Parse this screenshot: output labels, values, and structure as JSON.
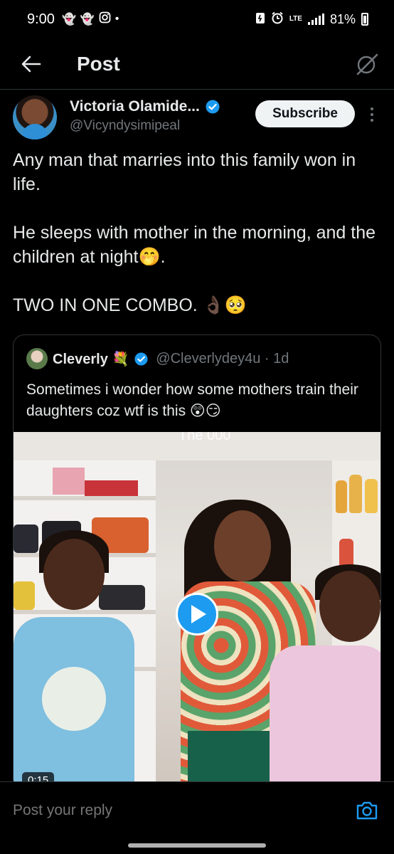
{
  "status_bar": {
    "time": "9:00",
    "left_icons": [
      "snapchat-icon",
      "snapchat-icon",
      "instagram-icon",
      "dot-icon"
    ],
    "lte": "LTE",
    "battery": "81%"
  },
  "header": {
    "title": "Post"
  },
  "author": {
    "name": "Victoria Olamide...",
    "handle": "@Vicyndysimipeal",
    "verified": true,
    "subscribe_label": "Subscribe"
  },
  "post": {
    "line1": "Any man that marries into this family won in life.",
    "line2": "He sleeps with mother in the morning, and the children at night🤭.",
    "line3": "TWO IN ONE COMBO. 👌🏿🥺"
  },
  "quote": {
    "name": "Cleverly 💐",
    "handle": "@Cleverlydey4u · 1d",
    "text": "Sometimes i wonder how some mothers train their daughters coz wtf is this 😲😏",
    "video": {
      "overlay_text": "The 000",
      "duration": "0:15"
    }
  },
  "reply": {
    "placeholder": "Post your reply"
  },
  "colors": {
    "background": "#000000",
    "accent": "#1d9bf0",
    "text_primary": "#e7e9ea",
    "text_secondary": "#71767b",
    "border": "#2f3336"
  }
}
